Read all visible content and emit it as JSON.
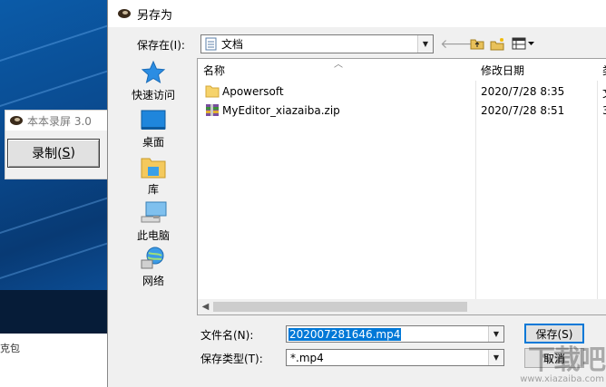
{
  "background": {
    "taskbar_text": "克包",
    "app_window": {
      "title": "本本录屏 3.0",
      "record_button": {
        "label": "录制(",
        "hotkey": "S",
        "suffix": ")"
      }
    }
  },
  "dialog": {
    "title": "另存为",
    "save_in": {
      "label": "保存在(I):",
      "value": "文档"
    },
    "toolbar": {
      "back_icon": "back-arrow-icon",
      "up_icon": "up-folder-icon",
      "new_folder_icon": "new-folder-icon",
      "view_icon": "view-menu-icon"
    },
    "places": [
      {
        "label": "快速访问",
        "icon": "quick-access-star-icon"
      },
      {
        "label": "桌面",
        "icon": "desktop-icon"
      },
      {
        "label": "库",
        "icon": "library-icon"
      },
      {
        "label": "此电脑",
        "icon": "computer-icon"
      },
      {
        "label": "网络",
        "icon": "network-icon"
      }
    ],
    "columns": {
      "name": "名称",
      "modified": "修改日期",
      "extra": "类"
    },
    "files": [
      {
        "name": "Apowersoft",
        "date": "2020/7/28 8:35",
        "extra": "文",
        "icon": "folder-icon"
      },
      {
        "name": "MyEditor_xiazaiba.zip",
        "date": "2020/7/28 8:51",
        "extra": "3",
        "icon": "zip-archive-icon"
      }
    ],
    "filename": {
      "label": "文件名(N):",
      "value": "202007281646.mp4"
    },
    "filetype": {
      "label": "保存类型(T):",
      "value": "*.mp4"
    },
    "buttons": {
      "save": "保存(S)",
      "cancel": "取消"
    }
  },
  "watermark": {
    "line1": "下载吧",
    "line2": "www.xiazaiba.com"
  },
  "colors": {
    "selection": "#0078d7",
    "desktop": "#0a4a8f"
  }
}
